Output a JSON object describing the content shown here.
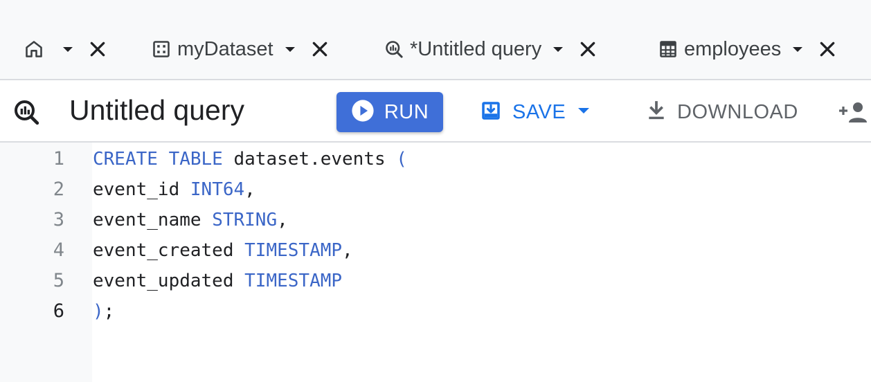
{
  "tabs": [
    {
      "icon": "home-icon",
      "label": ""
    },
    {
      "icon": "dataset-icon",
      "label": "myDataset"
    },
    {
      "icon": "query-icon",
      "label": "*Untitled query"
    },
    {
      "icon": "table-icon",
      "label": "employees"
    }
  ],
  "toolbar": {
    "title": "Untitled query",
    "run_label": "RUN",
    "save_label": "SAVE",
    "download_label": "DOWNLOAD"
  },
  "editor": {
    "lines": [
      {
        "number": "1",
        "tokens": [
          {
            "t": "CREATE TABLE",
            "kw": true
          },
          {
            "t": " dataset.events ",
            "kw": false
          },
          {
            "t": "(",
            "kw": true
          }
        ]
      },
      {
        "number": "2",
        "tokens": [
          {
            "t": "event_id ",
            "kw": false
          },
          {
            "t": "INT64",
            "kw": true
          },
          {
            "t": ",",
            "kw": false
          }
        ]
      },
      {
        "number": "3",
        "tokens": [
          {
            "t": "event_name ",
            "kw": false
          },
          {
            "t": "STRING",
            "kw": true
          },
          {
            "t": ",",
            "kw": false
          }
        ]
      },
      {
        "number": "4",
        "tokens": [
          {
            "t": "event_created ",
            "kw": false
          },
          {
            "t": "TIMESTAMP",
            "kw": true
          },
          {
            "t": ",",
            "kw": false
          }
        ]
      },
      {
        "number": "5",
        "tokens": [
          {
            "t": "event_updated ",
            "kw": false
          },
          {
            "t": "TIMESTAMP",
            "kw": true
          }
        ]
      },
      {
        "number": "6",
        "tokens": [
          {
            "t": ")",
            "kw": true
          },
          {
            "t": ";",
            "kw": false
          }
        ]
      }
    ],
    "active_line": "6"
  },
  "colors": {
    "accent": "#1a73e8",
    "run_button": "#3f6fd8",
    "keyword": "#3b66c7"
  }
}
